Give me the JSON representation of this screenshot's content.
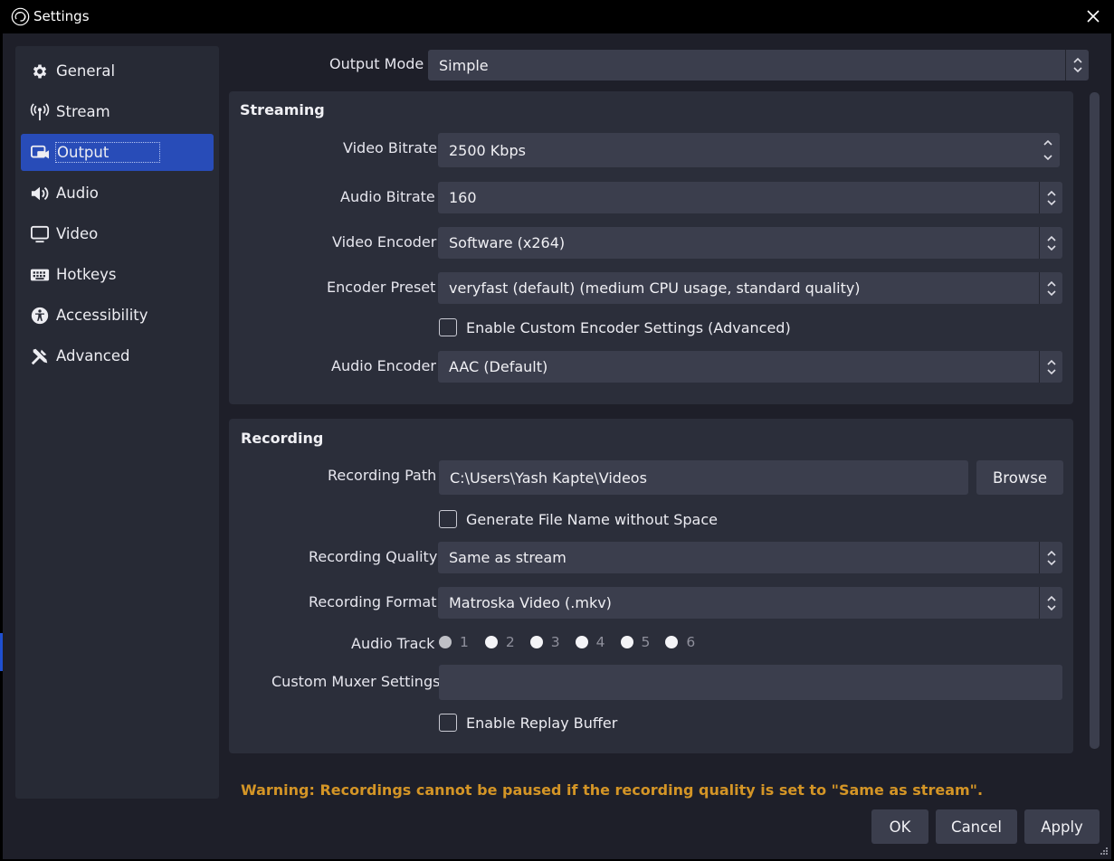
{
  "window": {
    "title": "Settings"
  },
  "sidebar": {
    "items": [
      {
        "label": "General",
        "icon": "gear-icon"
      },
      {
        "label": "Stream",
        "icon": "antenna-icon"
      },
      {
        "label": "Output",
        "icon": "output-icon",
        "active": true
      },
      {
        "label": "Audio",
        "icon": "speaker-icon"
      },
      {
        "label": "Video",
        "icon": "monitor-icon"
      },
      {
        "label": "Hotkeys",
        "icon": "keyboard-icon"
      },
      {
        "label": "Accessibility",
        "icon": "accessibility-icon"
      },
      {
        "label": "Advanced",
        "icon": "tools-icon"
      }
    ]
  },
  "output_mode": {
    "label": "Output Mode",
    "value": "Simple"
  },
  "streaming": {
    "title": "Streaming",
    "video_bitrate": {
      "label": "Video Bitrate",
      "value": "2500 Kbps"
    },
    "audio_bitrate": {
      "label": "Audio Bitrate",
      "value": "160"
    },
    "video_encoder": {
      "label": "Video Encoder",
      "value": "Software (x264)"
    },
    "encoder_preset": {
      "label": "Encoder Preset",
      "value": "veryfast (default) (medium CPU usage, standard quality)"
    },
    "custom_encoder_checkbox": {
      "label": "Enable Custom Encoder Settings (Advanced)",
      "checked": false
    },
    "audio_encoder": {
      "label": "Audio Encoder",
      "value": "AAC (Default)"
    }
  },
  "recording": {
    "title": "Recording",
    "path": {
      "label": "Recording Path",
      "value": "C:\\Users\\Yash Kapte\\Videos",
      "browse_label": "Browse"
    },
    "no_space_checkbox": {
      "label": "Generate File Name without Space",
      "checked": false
    },
    "quality": {
      "label": "Recording Quality",
      "value": "Same as stream"
    },
    "format": {
      "label": "Recording Format",
      "value": "Matroska Video (.mkv)"
    },
    "audio_track": {
      "label": "Audio Track",
      "tracks": [
        "1",
        "2",
        "3",
        "4",
        "5",
        "6"
      ],
      "selected": "1"
    },
    "muxer": {
      "label": "Custom Muxer Settings",
      "value": ""
    },
    "replay_checkbox": {
      "label": "Enable Replay Buffer",
      "checked": false
    }
  },
  "warning": "Warning: Recordings cannot be paused if the recording quality is set to \"Same as stream\".",
  "buttons": {
    "ok": "OK",
    "cancel": "Cancel",
    "apply": "Apply"
  },
  "colors": {
    "accent": "#284cb8",
    "warning": "#d49526",
    "background": "#1e1f29",
    "panel": "#2b2e3a",
    "field": "#3b3e4d"
  }
}
